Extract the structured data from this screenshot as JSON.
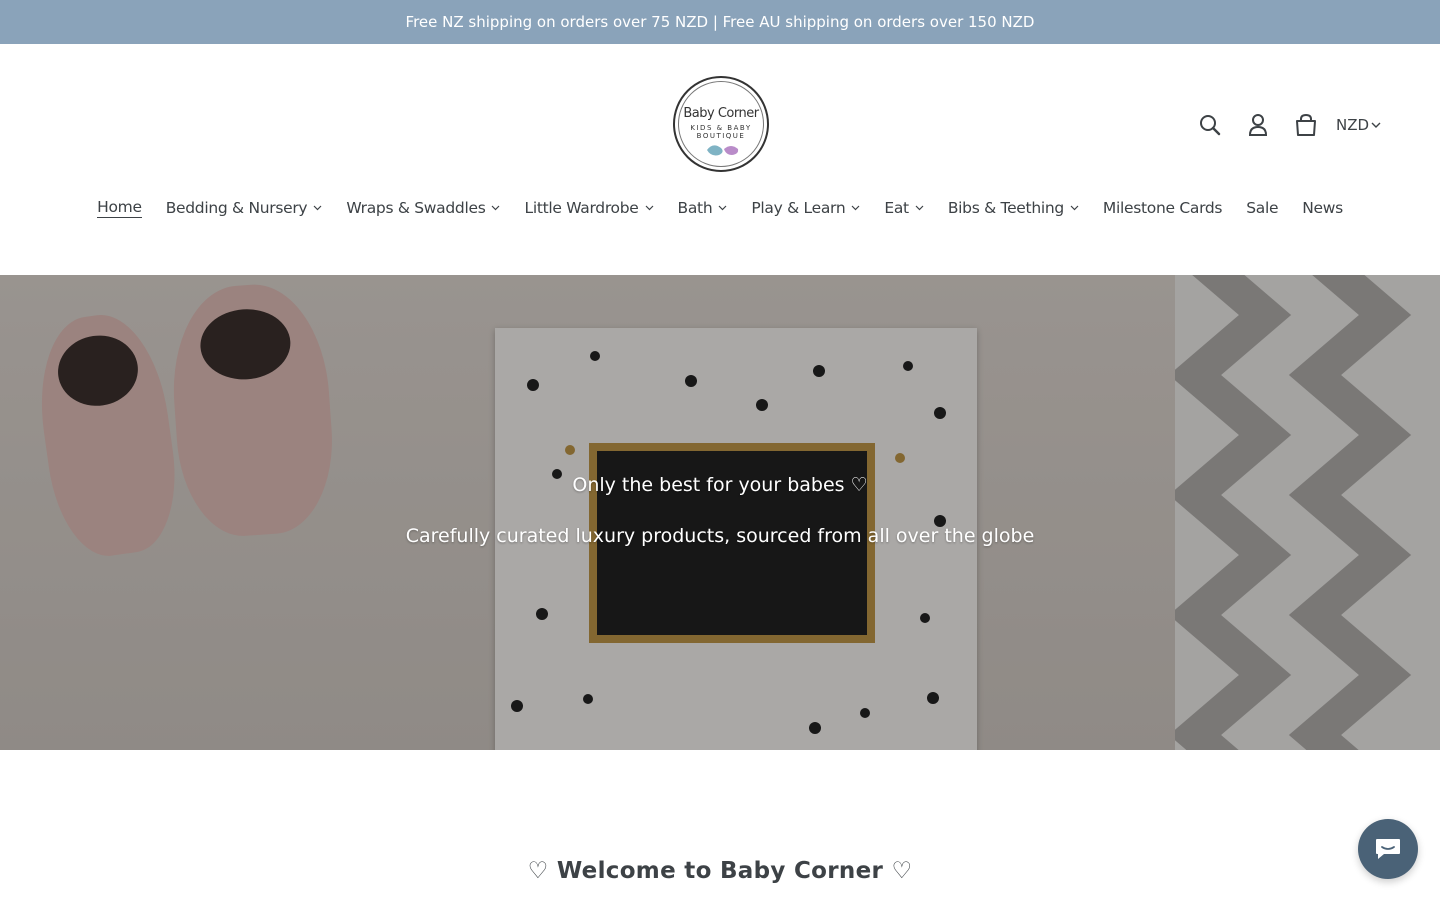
{
  "announcement": {
    "text": "Free NZ shipping on orders over 75 NZD | Free AU shipping on orders over 150 NZD"
  },
  "logo": {
    "title": "Baby Corner",
    "subtitle": "KIDS & BABY BOUTIQUE"
  },
  "header": {
    "icons": [
      "search-icon",
      "account-icon",
      "cart-icon"
    ],
    "currency": "NZD"
  },
  "nav": {
    "items": [
      {
        "label": "Home",
        "active": true,
        "dropdown": false
      },
      {
        "label": "Bedding & Nursery",
        "dropdown": true
      },
      {
        "label": "Wraps & Swaddles",
        "dropdown": true
      },
      {
        "label": "Little Wardrobe",
        "dropdown": true
      },
      {
        "label": "Bath",
        "dropdown": true
      },
      {
        "label": "Play & Learn",
        "dropdown": true
      },
      {
        "label": "Eat",
        "dropdown": true
      },
      {
        "label": "Bibs & Teething",
        "dropdown": true
      },
      {
        "label": "Milestone Cards",
        "dropdown": false
      },
      {
        "label": "Sale",
        "dropdown": false
      },
      {
        "label": "News",
        "dropdown": false
      }
    ]
  },
  "hero": {
    "heading": "Only the best for your babes ♡",
    "subheading": "Carefully curated luxury products, sourced from all over the globe"
  },
  "welcome": {
    "heading": "♡ Welcome to Baby Corner ♡"
  },
  "colors": {
    "announcement_bg": "#8aa3ba",
    "text": "#3d4246",
    "chat_button": "#4a6277"
  }
}
